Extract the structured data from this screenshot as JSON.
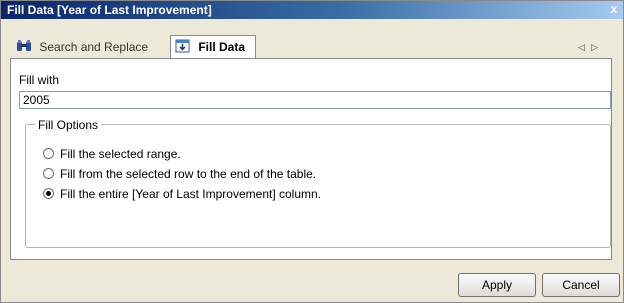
{
  "window": {
    "title": "Fill Data  [Year of Last Improvement]",
    "close_glyph": "x"
  },
  "tabs": [
    {
      "label": "Search and Replace",
      "icon": "binoculars-icon",
      "active": false
    },
    {
      "label": "Fill Data",
      "icon": "fill-data-icon",
      "active": true
    }
  ],
  "tab_nav": {
    "prev": "◁",
    "next": "▷"
  },
  "fill": {
    "label": "Fill with",
    "value": "2005"
  },
  "fill_options": {
    "legend": "Fill Options",
    "options": [
      {
        "label": "Fill the selected range.",
        "selected": false
      },
      {
        "label": "Fill from the selected row to the end of the table.",
        "selected": false
      },
      {
        "label": "Fill the entire [Year of Last Improvement] column.",
        "selected": true
      }
    ]
  },
  "buttons": {
    "apply": "Apply",
    "cancel": "Cancel"
  }
}
